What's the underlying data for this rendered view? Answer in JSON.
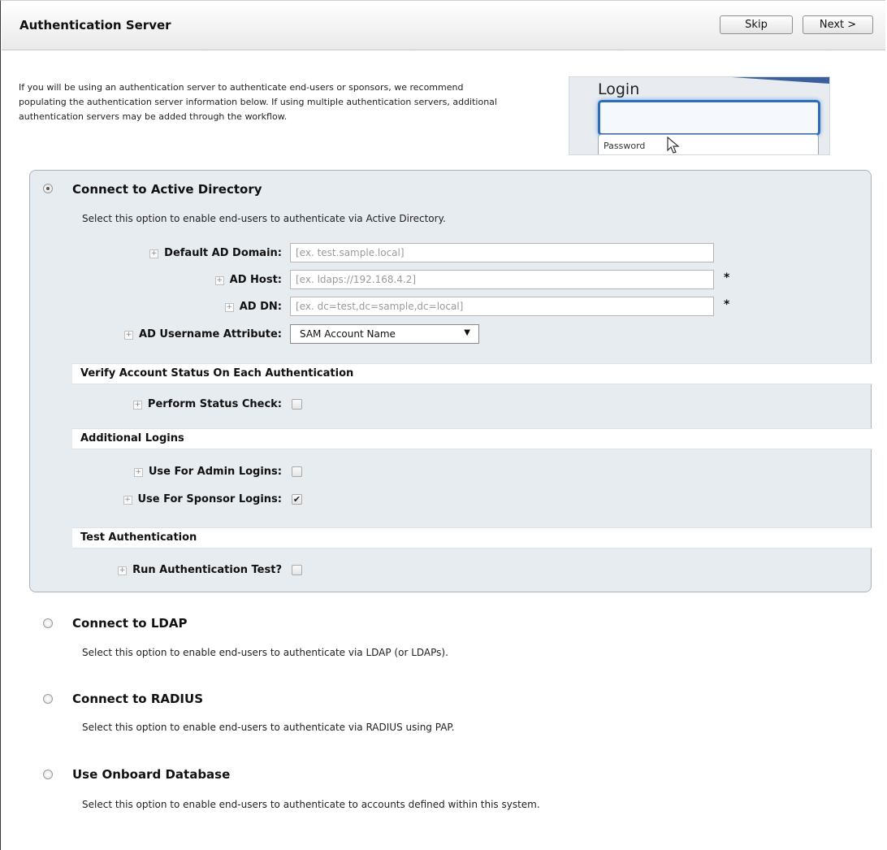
{
  "header": {
    "title": "Authentication Server",
    "skip_label": "Skip",
    "next_label": "Next >"
  },
  "intro": {
    "text": "If you will be using an authentication server to authenticate end-users or sponsors, we recommend populating the authentication server information below. If using multiple authentication servers, additional authentication servers may be added through the workflow."
  },
  "illustration": {
    "login_text": "Login",
    "password_text": "Password"
  },
  "options": {
    "ad": {
      "title": "Connect to Active Directory",
      "description": "Select this option to enable end-users to authenticate via Active Directory.",
      "selected": true,
      "fields": {
        "default_domain": {
          "label": "Default AD Domain:",
          "placeholder": "[ex. test.sample.local]",
          "value": ""
        },
        "host": {
          "label": "AD Host:",
          "placeholder": "[ex. ldaps://192.168.4.2]",
          "value": "",
          "required_mark": "*"
        },
        "dn": {
          "label": "AD DN:",
          "placeholder": "[ex. dc=test,dc=sample,dc=local]",
          "value": "",
          "required_mark": "*"
        },
        "username_attr": {
          "label": "AD Username Attribute:",
          "selected": "SAM Account Name"
        }
      },
      "verify": {
        "section_title": "Verify Account Status On Each Authentication",
        "status_check_label": "Perform Status Check:",
        "status_check_checked": false
      },
      "additional": {
        "section_title": "Additional Logins",
        "admin_label": "Use For Admin Logins:",
        "admin_checked": false,
        "sponsor_label": "Use For Sponsor Logins:",
        "sponsor_checked": true
      },
      "test": {
        "section_title": "Test Authentication",
        "run_label": "Run Authentication Test?",
        "run_checked": false
      }
    },
    "ldap": {
      "title": "Connect to LDAP",
      "description": "Select this option to enable end-users to authenticate via LDAP (or LDAPs).",
      "selected": false
    },
    "radius": {
      "title": "Connect to RADIUS",
      "description": "Select this option to enable end-users to authenticate via RADIUS using PAP.",
      "selected": false
    },
    "onboard": {
      "title": "Use Onboard Database",
      "description": "Select this option to enable end-users to authenticate to accounts defined within this system.",
      "selected": false
    }
  },
  "icons": {
    "expand": "+",
    "check": "✔",
    "caret": "▼"
  }
}
